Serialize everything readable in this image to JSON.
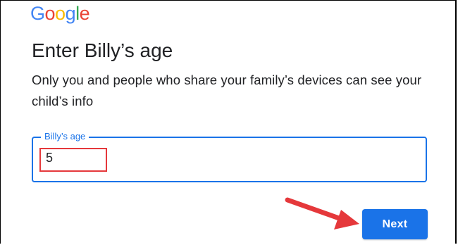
{
  "logo": {
    "letters": [
      {
        "char": "G",
        "color": "#4285F4"
      },
      {
        "char": "o",
        "color": "#EA4335"
      },
      {
        "char": "o",
        "color": "#FBBC05"
      },
      {
        "char": "g",
        "color": "#4285F4"
      },
      {
        "char": "l",
        "color": "#34A853"
      },
      {
        "char": "e",
        "color": "#EA4335"
      }
    ]
  },
  "header": {
    "title": "Enter Billy’s age",
    "subtitle": "Only you and people who share your family’s devices can see your child’s info"
  },
  "form": {
    "age_label": "Billy’s age",
    "age_value": "5"
  },
  "actions": {
    "next_label": "Next"
  },
  "colors": {
    "accent": "#1a73e8",
    "annotation": "#e5383b"
  }
}
